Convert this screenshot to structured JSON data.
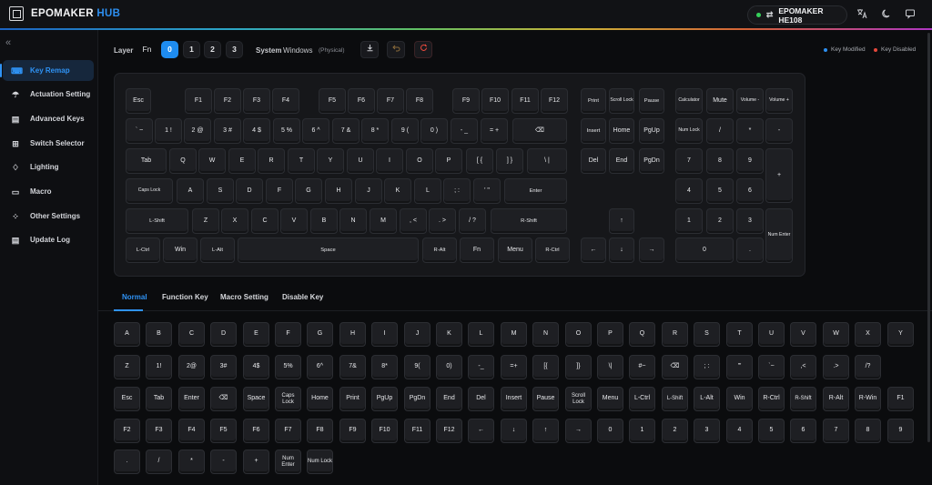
{
  "app": {
    "logo_main": "EPOMAKER",
    "logo_hub": "HUB",
    "device": "EPOMAKER HE108",
    "device_status_color": "#35d05a",
    "accent": "#2f93f5",
    "header_icons": [
      "translate-icon",
      "moon-icon",
      "chat-icon"
    ]
  },
  "sidebar": {
    "items": [
      {
        "label": "Key Remap",
        "icon": "keyboard-icon",
        "active": true
      },
      {
        "label": "Actuation Setting",
        "icon": "lightbulb-icon"
      },
      {
        "label": "Advanced Keys",
        "icon": "advanced-keys-icon"
      },
      {
        "label": "Switch Selector",
        "icon": "switch-icon"
      },
      {
        "label": "Lighting",
        "icon": "bulb-icon"
      },
      {
        "label": "Macro",
        "icon": "macro-icon"
      },
      {
        "label": "Other Settings",
        "icon": "grid-icon"
      },
      {
        "label": "Update Log",
        "icon": "document-icon"
      }
    ]
  },
  "layer": {
    "label": "Layer",
    "fn": "Fn",
    "layers": [
      "0",
      "1",
      "2",
      "3"
    ],
    "active": "0",
    "system_label": "System",
    "system_value": "Windows",
    "system_mode": "(Physical)"
  },
  "legend": {
    "modified": "Key Modified",
    "modified_color": "#2d8ff0",
    "disabled": "Key Disabled",
    "disabled_color": "#e5483b"
  },
  "keyboard": {
    "rows": [
      [
        "Esc",
        "F1",
        "F2",
        "F3",
        "F4",
        "F5",
        "F6",
        "F7",
        "F8",
        "F9",
        "F10",
        "F11",
        "F12",
        "Print",
        "Scroll Lock",
        "Pause",
        "Calculator",
        "Mute",
        "Volume -",
        "Volume +"
      ],
      [
        "` ~",
        "1 !",
        "2 @",
        "3 #",
        "4 $",
        "5 %",
        "6 ^",
        "7 &",
        "8 *",
        "9 (",
        "0 )",
        "- _",
        "= +",
        "⌫",
        "Insert",
        "Home",
        "PgUp",
        "Num Lock",
        "/",
        "*",
        "-"
      ],
      [
        "Tab",
        "Q",
        "W",
        "E",
        "R",
        "T",
        "Y",
        "U",
        "I",
        "O",
        "P",
        "[ {",
        "] }",
        "\\ |",
        "Del",
        "End",
        "PgDn",
        "7",
        "8",
        "9",
        "+"
      ],
      [
        "Caps Lock",
        "A",
        "S",
        "D",
        "F",
        "G",
        "H",
        "J",
        "K",
        "L",
        "; :",
        "' \"",
        "Enter",
        "4",
        "5",
        "6"
      ],
      [
        "L-Shift",
        "Z",
        "X",
        "C",
        "V",
        "B",
        "N",
        "M",
        ", <",
        ". >",
        "/ ?",
        "R-Shift",
        "↑",
        "1",
        "2",
        "3",
        "Num Enter"
      ],
      [
        "L-Ctrl",
        "Win",
        "L-Alt",
        "Space",
        "R-Alt",
        "Fn",
        "Menu",
        "R-Ctrl",
        "←",
        "↓",
        "→",
        "0",
        "."
      ]
    ]
  },
  "tabs": [
    "Normal",
    "Function Key",
    "Macro Setting",
    "Disable Key"
  ],
  "active_tab": "Normal",
  "picker": {
    "rows": [
      [
        "A",
        "B",
        "C",
        "D",
        "E",
        "F",
        "G",
        "H",
        "I",
        "J",
        "K",
        "L",
        "M",
        "N",
        "O",
        "P",
        "Q",
        "R",
        "S",
        "T",
        "U",
        "V",
        "W",
        "X",
        "Y"
      ],
      [
        "Z",
        "1!",
        "2@",
        "3#",
        "4$",
        "5%",
        "6^",
        "7&",
        "8*",
        "9(",
        "0)",
        "-_",
        "=+",
        "[{",
        "]}",
        "\\|",
        "#~",
        "⌫",
        "; :",
        "'\"",
        "`~",
        ",<",
        ".>",
        "/?"
      ],
      [
        "Esc",
        "Tab",
        "Enter",
        "⌫",
        "Space",
        "Caps Lock",
        "Home",
        "Print",
        "PgUp",
        "PgDn",
        "End",
        "Del",
        "Insert",
        "Pause",
        "Scroll Lock",
        "Menu",
        "L-Ctrl",
        "L-Shift",
        "L-Alt",
        "Win",
        "R-Ctrl",
        "R-Shift",
        "R-Alt",
        "R-Win",
        "F1"
      ],
      [
        "F2",
        "F3",
        "F4",
        "F5",
        "F6",
        "F7",
        "F8",
        "F9",
        "F10",
        "F11",
        "F12",
        "←",
        "↓",
        "↑",
        "→",
        "0",
        "1",
        "2",
        "3",
        "4",
        "5",
        "6",
        "7",
        "8",
        "9"
      ],
      [
        ".",
        "/",
        "*",
        "-",
        "+",
        "Num Enter",
        "Num Lock"
      ]
    ]
  }
}
